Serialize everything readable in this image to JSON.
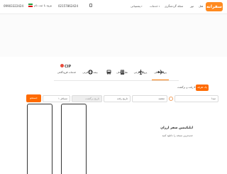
{
  "header": {
    "logo_text": "سفرانه",
    "nav": [
      {
        "label": "هتل"
      },
      {
        "label": "تور"
      },
      {
        "label": "مجله گردشگری"
      },
      {
        "label": "خدمات"
      },
      {
        "label": "پشتیبانی"
      }
    ],
    "phone_1": "02157862424",
    "phone_2": "09903322424",
    "login_label": "ورود یا ثبت نام"
  },
  "tabs": [
    {
      "label": "پرواز داخلی",
      "icon": "plane-icon",
      "active": true
    },
    {
      "label": "پرواز خارجی",
      "icon": "plane-icon"
    },
    {
      "label": "هتل داخلی",
      "icon": "hotel-icon"
    },
    {
      "label": "تور",
      "icon": "bus-icon"
    },
    {
      "label": "بیمه مسافرتی",
      "icon": "insurance-icon"
    },
    {
      "label": "خدمات فرودگاهی",
      "icon": "cip-icon",
      "badge": "CIP"
    }
  ],
  "trip_type": {
    "one_way": "یک طرفه",
    "round_trip": "رفت و برگشت"
  },
  "search": {
    "origin": "مبدا",
    "destination": "مقصد",
    "departure": "تاریخ رفت",
    "return": "تاریخ برگشت",
    "passengers": "۱ مسافر",
    "button": "جستجو"
  },
  "promo": {
    "title": "اپلیکیشن سفر ارزان",
    "subtitle": "جدیدترین نسخه را دانلود کنید"
  },
  "colors": {
    "accent": "#ff6a00"
  }
}
